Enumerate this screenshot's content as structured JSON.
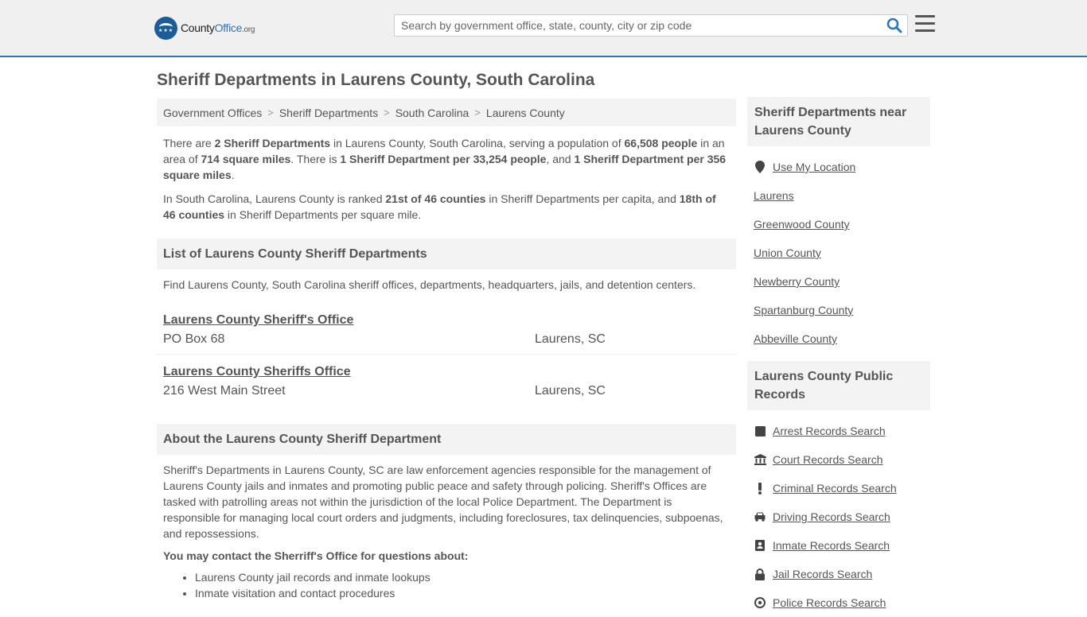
{
  "header": {
    "logo_main": "County",
    "logo_accent": "Office",
    "logo_tld": ".org",
    "search_placeholder": "Search by government office, state, county, city or zip code"
  },
  "page_title": "Sheriff Departments in Laurens County, South Carolina",
  "breadcrumb": [
    "Government Offices",
    "Sheriff Departments",
    "South Carolina",
    "Laurens County"
  ],
  "intro": {
    "p1": [
      {
        "t": "There are "
      },
      {
        "b": "2 Sheriff Departments"
      },
      {
        "t": " in Laurens County, South Carolina, serving a population of "
      },
      {
        "b": "66,508 people"
      },
      {
        "t": " in an area of "
      },
      {
        "b": "714 square miles"
      },
      {
        "t": ". There is "
      },
      {
        "b": "1 Sheriff Department per 33,254 people"
      },
      {
        "t": ", and "
      },
      {
        "b": "1 Sheriff Department per 356 square miles"
      },
      {
        "t": "."
      }
    ],
    "p2": [
      {
        "t": "In South Carolina, Laurens County is ranked "
      },
      {
        "b": "21st of 46 counties"
      },
      {
        "t": " in Sheriff Departments per capita, and "
      },
      {
        "b": "18th of 46 counties"
      },
      {
        "t": " in Sheriff Departments per square mile."
      }
    ]
  },
  "list_section": {
    "title": "List of Laurens County Sheriff Departments",
    "description": "Find Laurens County, South Carolina sheriff offices, departments, headquarters, jails, and detention centers.",
    "items": [
      {
        "name": "Laurens County Sheriff's Office",
        "address": "PO Box 68",
        "city": "Laurens, SC"
      },
      {
        "name": "Laurens County Sheriffs Office",
        "address": "216 West Main Street",
        "city": "Laurens, SC"
      }
    ]
  },
  "about": {
    "title": "About the Laurens County Sheriff Department",
    "body": "Sheriff's Departments in Laurens County, SC are law enforcement agencies responsible for the management of Laurens County jails and inmates and promoting public peace and safety through policing. Sheriff's Offices are tasked with patrolling areas not within the jurisdiction of the local Police Department. The Department is responsible for managing local court orders and judgments, including foreclosures, tax delinquencies, subpoenas, and repossessions.",
    "contact_title": "You may contact the Sherriff's Office for questions about:",
    "contact_items": [
      "Laurens County jail records and inmate lookups",
      "Inmate visitation and contact procedures"
    ]
  },
  "sidebar": {
    "nearby_title": "Sheriff Departments near Laurens County",
    "nearby_items": [
      {
        "label": "Use My Location",
        "icon": "map-marker-icon"
      },
      {
        "label": "Laurens"
      },
      {
        "label": "Greenwood County"
      },
      {
        "label": "Union County"
      },
      {
        "label": "Newberry County"
      },
      {
        "label": "Spartanburg County"
      },
      {
        "label": "Abbeville County"
      }
    ],
    "records_title": "Laurens County Public Records",
    "records_items": [
      {
        "label": "Arrest Records Search",
        "icon": "square-icon"
      },
      {
        "label": "Court Records Search",
        "icon": "courthouse-icon"
      },
      {
        "label": "Criminal Records Search",
        "icon": "exclamation-icon"
      },
      {
        "label": "Driving Records Search",
        "icon": "car-icon"
      },
      {
        "label": "Inmate Records Search",
        "icon": "id-badge-icon"
      },
      {
        "label": "Jail Records Search",
        "icon": "lock-icon"
      },
      {
        "label": "Police Records Search",
        "icon": "police-badge-icon"
      }
    ]
  },
  "colors": {
    "accent": "#2d77b8",
    "logo": "#1c5c98",
    "panel": "#f3f3f3",
    "text": "#555555"
  }
}
